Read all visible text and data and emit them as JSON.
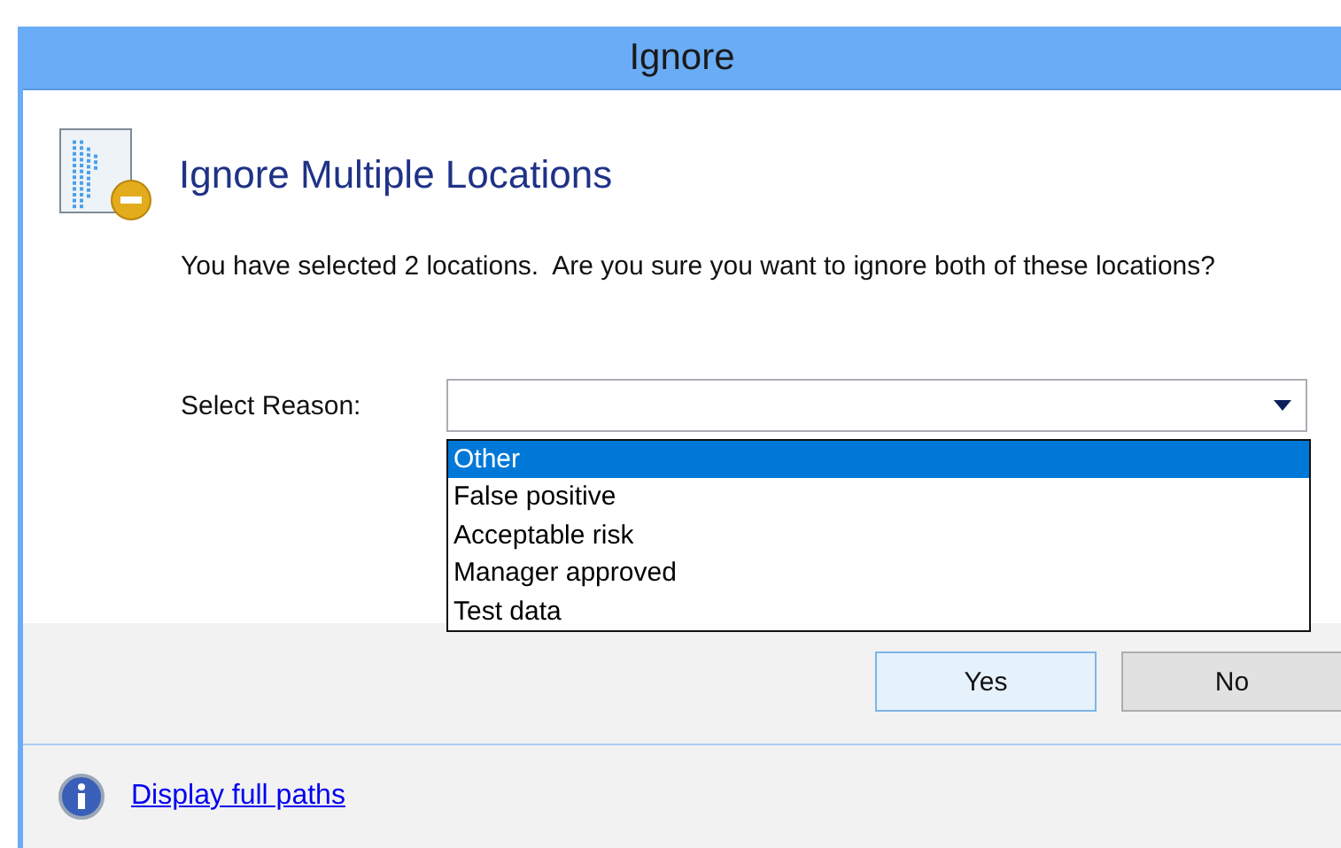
{
  "window": {
    "title": "Ignore"
  },
  "heading": "Ignore Multiple Locations",
  "message": "You have selected 2 locations.  Are you sure you want to ignore both of these locations?",
  "reason": {
    "label": "Select Reason:",
    "expanded": true,
    "options": [
      {
        "label": "Other",
        "selected": true
      },
      {
        "label": "False positive",
        "selected": false
      },
      {
        "label": "Acceptable risk",
        "selected": false
      },
      {
        "label": "Manager approved",
        "selected": false
      },
      {
        "label": "Test data",
        "selected": false
      }
    ]
  },
  "buttons": [
    {
      "label": "Yes",
      "default": true
    },
    {
      "label": "No",
      "default": false
    }
  ],
  "footer": {
    "link": "Display full paths"
  }
}
